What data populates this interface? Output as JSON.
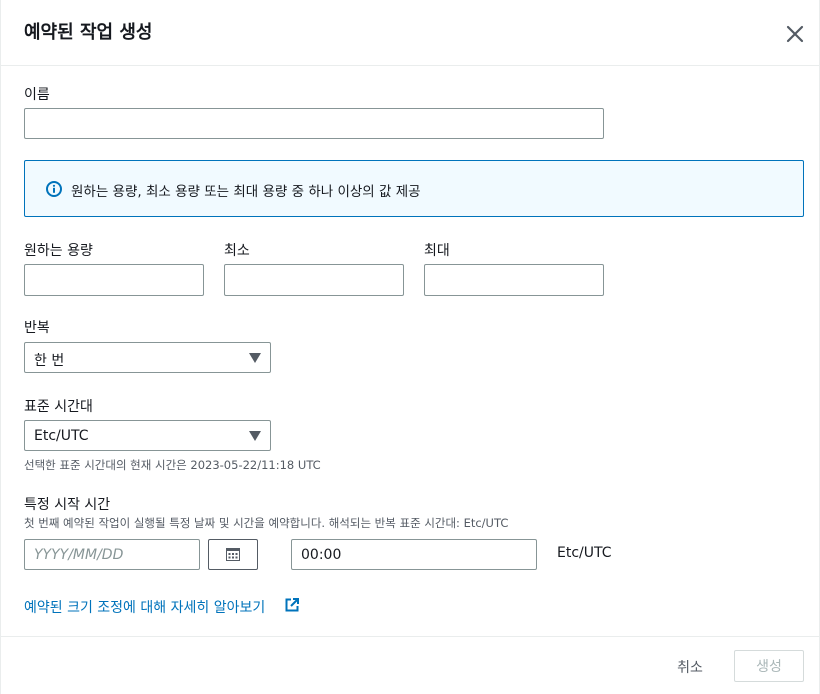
{
  "dialog": {
    "title": "예약된 작업 생성"
  },
  "form": {
    "name_label": "이름",
    "name_value": "",
    "info_text": "원하는 용량, 최소 용량 또는 최대 용량 중 하나 이상의 값 제공",
    "desired_label": "원하는 용량",
    "min_label": "최소",
    "max_label": "최대",
    "recurrence_label": "반복",
    "recurrence_value": "한 번",
    "timezone_label": "표준 시간대",
    "timezone_value": "Etc/UTC",
    "timezone_hint": "선택한 표준 시간대의 현재 시간은 2023-05-22/11:18 UTC",
    "start_label": "특정 시작 시간",
    "start_hint": "첫 번째 예약된 작업이 실행될 특정 날짜 및 시간을 예약합니다. 해석되는 반복 표준 시간대: Etc/UTC",
    "date_placeholder": "YYYY/MM/DD",
    "time_value": "00:00",
    "time_tz": "Etc/UTC",
    "learn_more": "예약된 크기 조정에 대해 자세히 알아보기"
  },
  "footer": {
    "cancel": "취소",
    "create": "생성"
  },
  "colors": {
    "link": "#0073bb",
    "info_bg": "#f1faff",
    "border": "#879596"
  },
  "icons": [
    "close-icon",
    "info-icon",
    "caret-down-icon",
    "calendar-icon",
    "external-link-icon"
  ]
}
